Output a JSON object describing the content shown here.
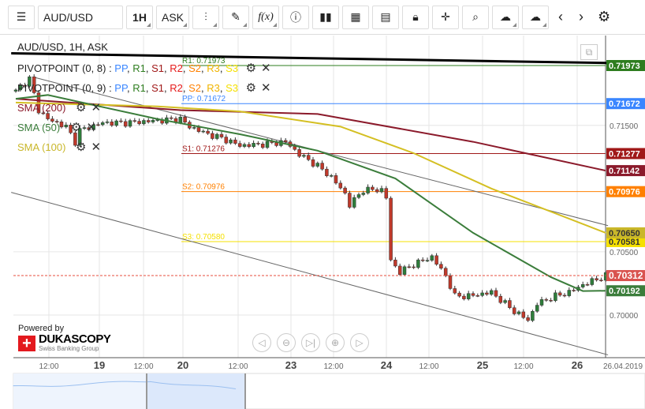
{
  "toolbar": {
    "symbol": "AUD/USD",
    "timeframe": "1H",
    "side": "ASK",
    "fx": "f(x)",
    "icons": [
      "menu-icon",
      "candlestick-icon",
      "pencil-icon",
      "function-icon",
      "info-icon",
      "bar-chart-icon",
      "calendar-icon",
      "document-icon",
      "lock-icon",
      "crosshair-icon",
      "zoom-icon",
      "cloud-upload-icon",
      "cloud-download-icon",
      "chevron-left-icon",
      "chevron-right-icon",
      "gear-icon"
    ]
  },
  "legend": {
    "title": "AUD/USD, 1H, ASK",
    "pivot1": "PIVOTPOINT (0, 8)",
    "pivot2": "PIVOTPOINT (0, 9)",
    "sep": " : ",
    "pp": "PP",
    "r1": "R1",
    "s1": "S1",
    "r2": "R2",
    "s2": "S2",
    "r3": "R3",
    "s3": "S3",
    "sma200": "SMA (200)",
    "sma50": "SMA (50)",
    "sma100": "SMA (100)"
  },
  "branding": {
    "powered": "Powered by",
    "name": "DUKASCOPY",
    "sub": "Swiss Banking Group"
  },
  "chart_data": {
    "type": "line",
    "title": "AUD/USD, 1H, ASK",
    "ylim": [
      0.6962,
      0.7218
    ],
    "yticks": [
      "0.71500",
      "0.70500",
      "0.70000"
    ],
    "ytick_values": [
      0.715,
      0.705,
      0.7
    ],
    "xticks": [
      "12:00",
      "19",
      "12:00",
      "20",
      "12:00",
      "23",
      "12:00",
      "24",
      "12:00",
      "25",
      "12:00",
      "26",
      "26.04.2019"
    ],
    "candles_count": 130,
    "close_anchors": [
      [
        0,
        0.7177
      ],
      [
        3,
        0.7187
      ],
      [
        5,
        0.7162
      ],
      [
        7,
        0.7155
      ],
      [
        11,
        0.7149
      ],
      [
        13,
        0.7137
      ],
      [
        14,
        0.7146
      ],
      [
        19,
        0.7152
      ],
      [
        24,
        0.7152
      ],
      [
        36,
        0.7155
      ],
      [
        38,
        0.7149
      ],
      [
        42,
        0.7143
      ],
      [
        45,
        0.714
      ],
      [
        49,
        0.7134
      ],
      [
        54,
        0.7135
      ],
      [
        59,
        0.7137
      ],
      [
        62,
        0.7127
      ],
      [
        66,
        0.7118
      ],
      [
        69,
        0.7109
      ],
      [
        72,
        0.7096
      ],
      [
        73,
        0.7087
      ],
      [
        76,
        0.7099
      ],
      [
        80,
        0.7099
      ],
      [
        81,
        0.7093
      ],
      [
        82,
        0.7043
      ],
      [
        84,
        0.7034
      ],
      [
        87,
        0.704
      ],
      [
        91,
        0.7046
      ],
      [
        94,
        0.7031
      ],
      [
        96,
        0.7015
      ],
      [
        99,
        0.7015
      ],
      [
        104,
        0.7018
      ],
      [
        109,
        0.7003
      ],
      [
        112,
        0.6996
      ],
      [
        114,
        0.7009
      ],
      [
        118,
        0.7015
      ],
      [
        121,
        0.7018
      ],
      [
        124,
        0.7024
      ],
      [
        129,
        0.7031
      ]
    ],
    "series": [
      {
        "name": "SMA (200)",
        "color": "#8b1a2b",
        "points": [
          [
            0,
            0.7171
          ],
          [
            36,
            0.7162
          ],
          [
            66,
            0.7159
          ],
          [
            100,
            0.7137
          ],
          [
            129,
            0.71142
          ]
        ]
      },
      {
        "name": "SMA (100)",
        "color": "#d4bf22",
        "points": [
          [
            0,
            0.7168
          ],
          [
            31,
            0.7165
          ],
          [
            49,
            0.7161
          ],
          [
            71,
            0.7149
          ],
          [
            87,
            0.7128
          ],
          [
            104,
            0.71
          ],
          [
            129,
            0.7065
          ]
        ]
      },
      {
        "name": "SMA (50)",
        "color": "#3b7d3b",
        "points": [
          [
            0,
            0.7171
          ],
          [
            7,
            0.7174
          ],
          [
            31,
            0.7155
          ],
          [
            49,
            0.7143
          ],
          [
            66,
            0.713
          ],
          [
            83,
            0.7108
          ],
          [
            100,
            0.7065
          ],
          [
            117,
            0.703
          ],
          [
            124,
            0.7019
          ],
          [
            129,
            0.70192
          ]
        ]
      }
    ],
    "pivots": [
      {
        "name": "R1",
        "label": "R1: 0.71973",
        "value": 0.71973,
        "color": "#2e7d1f",
        "tag": "0.71973"
      },
      {
        "name": "PP",
        "label": "PP: 0.71672",
        "value": 0.71672,
        "color": "#3a86ff",
        "tag": "0.71672"
      },
      {
        "name": "S1",
        "label": "S1: 0.71276",
        "value": 0.71277,
        "color": "#a01818",
        "tag": "0.71277"
      },
      {
        "name": "S2",
        "label": "S2: 0.70976",
        "value": 0.70976,
        "color": "#ff8000",
        "tag": "0.70976"
      },
      {
        "name": "S3",
        "label": "S3: 0.70580",
        "value": 0.70581,
        "color": "#f5e000",
        "tag": "0.70581"
      }
    ],
    "price_tags": [
      {
        "value": 0.71142,
        "color": "#8b1a2b",
        "text": "0.71142"
      },
      {
        "value": 0.7065,
        "color": "#c9b72a",
        "text": "0.70650"
      },
      {
        "value": 0.70312,
        "color": "#d9534f",
        "text": "0.70312"
      },
      {
        "value": 0.70192,
        "color": "#3b7d3b",
        "text": "0.70192"
      }
    ],
    "current_price": 0.70312,
    "trendlines": [
      {
        "color": "#000",
        "from": [
          -1,
          0.7207
        ],
        "to": [
          129.5,
          0.71993
        ]
      },
      {
        "color": "#666",
        "from": [
          -1,
          0.7097
        ],
        "to": [
          129.5,
          0.69685
        ]
      },
      {
        "color": "#666",
        "from": [
          4,
          0.7188
        ],
        "to": [
          129.5,
          0.70707
        ]
      }
    ]
  }
}
